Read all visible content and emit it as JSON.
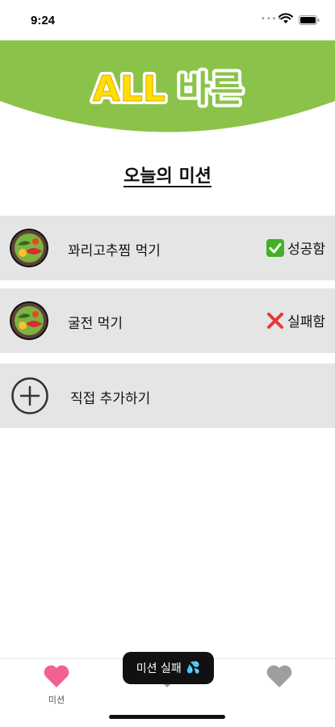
{
  "status_bar": {
    "time": "9:24",
    "dots": "••••"
  },
  "header": {
    "logo_text_1": "ALL",
    "logo_text_2": "바른",
    "accent_color": "#8bc34a",
    "logo_yellow": "#ffe000"
  },
  "section_title": "오늘의 미션",
  "missions": [
    {
      "label": "꽈리고추찜 먹기",
      "status": "성공함",
      "status_icon": "check-icon"
    },
    {
      "label": "굴전 먹기",
      "status": "실패함",
      "status_icon": "x-icon"
    }
  ],
  "add_row": {
    "label": "직접 추가하기"
  },
  "tab_bar": {
    "tabs": [
      {
        "label": "미션",
        "icon": "heart-icon",
        "color": "#f06292"
      },
      {
        "label": "",
        "icon": "heart-icon",
        "color": "#9e9e9e"
      },
      {
        "label": "",
        "icon": "heart-icon",
        "color": "#9e9e9e"
      }
    ]
  },
  "toast": {
    "text": "미션 실패",
    "emoji": "💦"
  }
}
